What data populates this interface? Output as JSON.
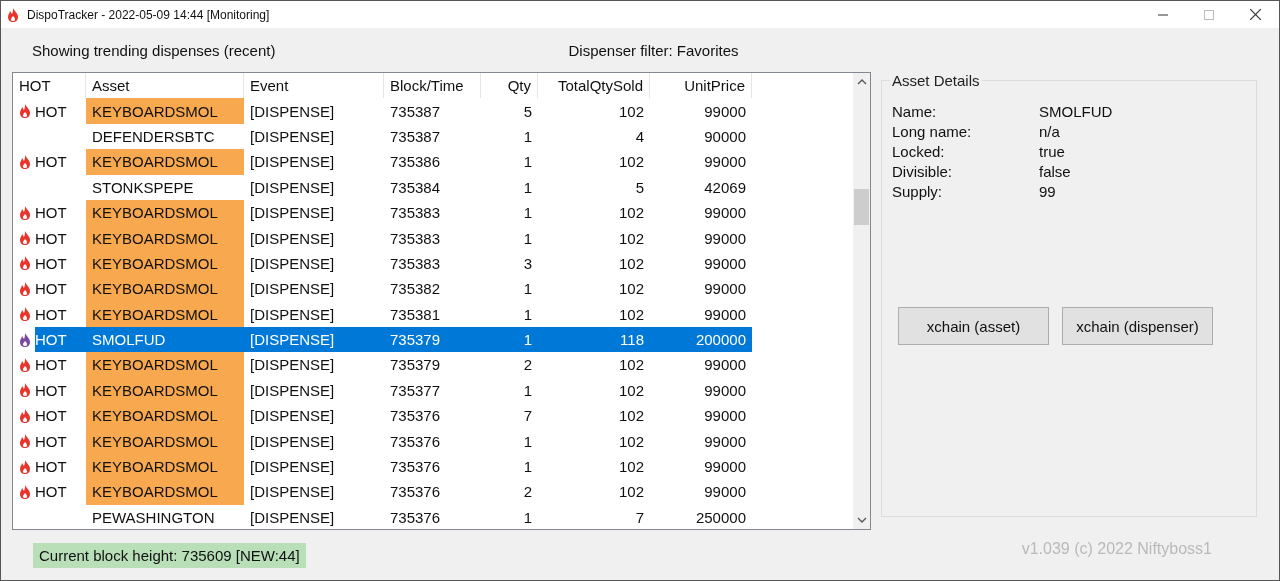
{
  "window": {
    "title": "DispoTracker - 2022-05-09 14:44 [Monitoring]"
  },
  "header": {
    "mode": "Showing trending dispenses (recent)",
    "filter": "Dispenser filter: Favorites"
  },
  "table": {
    "columns": [
      "HOT",
      "Asset",
      "Event",
      "Block/Time",
      "Qty",
      "TotalQtySold",
      "UnitPrice"
    ],
    "rows": [
      {
        "hot": true,
        "hot_label": "HOT",
        "asset": "KEYBOARDSMOL",
        "highlighted": true,
        "event": "[DISPENSE]",
        "block": "735387",
        "qty": "5",
        "total": "102",
        "price": "99000",
        "selected": false
      },
      {
        "hot": false,
        "asset": "DEFENDERSBTC",
        "highlighted": false,
        "event": "[DISPENSE]",
        "block": "735387",
        "qty": "1",
        "total": "4",
        "price": "90000",
        "selected": false
      },
      {
        "hot": true,
        "hot_label": "HOT",
        "asset": "KEYBOARDSMOL",
        "highlighted": true,
        "event": "[DISPENSE]",
        "block": "735386",
        "qty": "1",
        "total": "102",
        "price": "99000",
        "selected": false
      },
      {
        "hot": false,
        "asset": "STONKSPEPE",
        "highlighted": false,
        "event": "[DISPENSE]",
        "block": "735384",
        "qty": "1",
        "total": "5",
        "price": "42069",
        "selected": false
      },
      {
        "hot": true,
        "hot_label": "HOT",
        "asset": "KEYBOARDSMOL",
        "highlighted": true,
        "event": "[DISPENSE]",
        "block": "735383",
        "qty": "1",
        "total": "102",
        "price": "99000",
        "selected": false
      },
      {
        "hot": true,
        "hot_label": "HOT",
        "asset": "KEYBOARDSMOL",
        "highlighted": true,
        "event": "[DISPENSE]",
        "block": "735383",
        "qty": "1",
        "total": "102",
        "price": "99000",
        "selected": false
      },
      {
        "hot": true,
        "hot_label": "HOT",
        "asset": "KEYBOARDSMOL",
        "highlighted": true,
        "event": "[DISPENSE]",
        "block": "735383",
        "qty": "3",
        "total": "102",
        "price": "99000",
        "selected": false
      },
      {
        "hot": true,
        "hot_label": "HOT",
        "asset": "KEYBOARDSMOL",
        "highlighted": true,
        "event": "[DISPENSE]",
        "block": "735382",
        "qty": "1",
        "total": "102",
        "price": "99000",
        "selected": false
      },
      {
        "hot": true,
        "hot_label": "HOT",
        "asset": "KEYBOARDSMOL",
        "highlighted": true,
        "event": "[DISPENSE]",
        "block": "735381",
        "qty": "1",
        "total": "102",
        "price": "99000",
        "selected": false
      },
      {
        "hot": true,
        "hot_label": "HOT",
        "asset": "SMOLFUD",
        "highlighted": false,
        "event": "[DISPENSE]",
        "block": "735379",
        "qty": "1",
        "total": "118",
        "price": "200000",
        "selected": true
      },
      {
        "hot": true,
        "hot_label": "HOT",
        "asset": "KEYBOARDSMOL",
        "highlighted": true,
        "event": "[DISPENSE]",
        "block": "735379",
        "qty": "2",
        "total": "102",
        "price": "99000",
        "selected": false
      },
      {
        "hot": true,
        "hot_label": "HOT",
        "asset": "KEYBOARDSMOL",
        "highlighted": true,
        "event": "[DISPENSE]",
        "block": "735377",
        "qty": "1",
        "total": "102",
        "price": "99000",
        "selected": false
      },
      {
        "hot": true,
        "hot_label": "HOT",
        "asset": "KEYBOARDSMOL",
        "highlighted": true,
        "event": "[DISPENSE]",
        "block": "735376",
        "qty": "7",
        "total": "102",
        "price": "99000",
        "selected": false
      },
      {
        "hot": true,
        "hot_label": "HOT",
        "asset": "KEYBOARDSMOL",
        "highlighted": true,
        "event": "[DISPENSE]",
        "block": "735376",
        "qty": "1",
        "total": "102",
        "price": "99000",
        "selected": false
      },
      {
        "hot": true,
        "hot_label": "HOT",
        "asset": "KEYBOARDSMOL",
        "highlighted": true,
        "event": "[DISPENSE]",
        "block": "735376",
        "qty": "1",
        "total": "102",
        "price": "99000",
        "selected": false
      },
      {
        "hot": true,
        "hot_label": "HOT",
        "asset": "KEYBOARDSMOL",
        "highlighted": true,
        "event": "[DISPENSE]",
        "block": "735376",
        "qty": "2",
        "total": "102",
        "price": "99000",
        "selected": false
      },
      {
        "hot": false,
        "asset": "PEWASHINGTON",
        "highlighted": false,
        "event": "[DISPENSE]",
        "block": "735376",
        "qty": "1",
        "total": "7",
        "price": "250000",
        "selected": false
      }
    ]
  },
  "details": {
    "title": "Asset Details",
    "fields": [
      {
        "label": "Name:",
        "value": "SMOLFUD"
      },
      {
        "label": "Long name:",
        "value": "n/a"
      },
      {
        "label": "Locked:",
        "value": "true"
      },
      {
        "label": "Divisible:",
        "value": "false"
      },
      {
        "label": "Supply:",
        "value": "99"
      }
    ],
    "buttons": [
      "xchain (asset)",
      "xchain (dispenser)"
    ]
  },
  "status": {
    "block_height": "Current block height: 735609 [NEW:44]",
    "version": "v1.039 (c) 2022 Niftyboss1"
  }
}
